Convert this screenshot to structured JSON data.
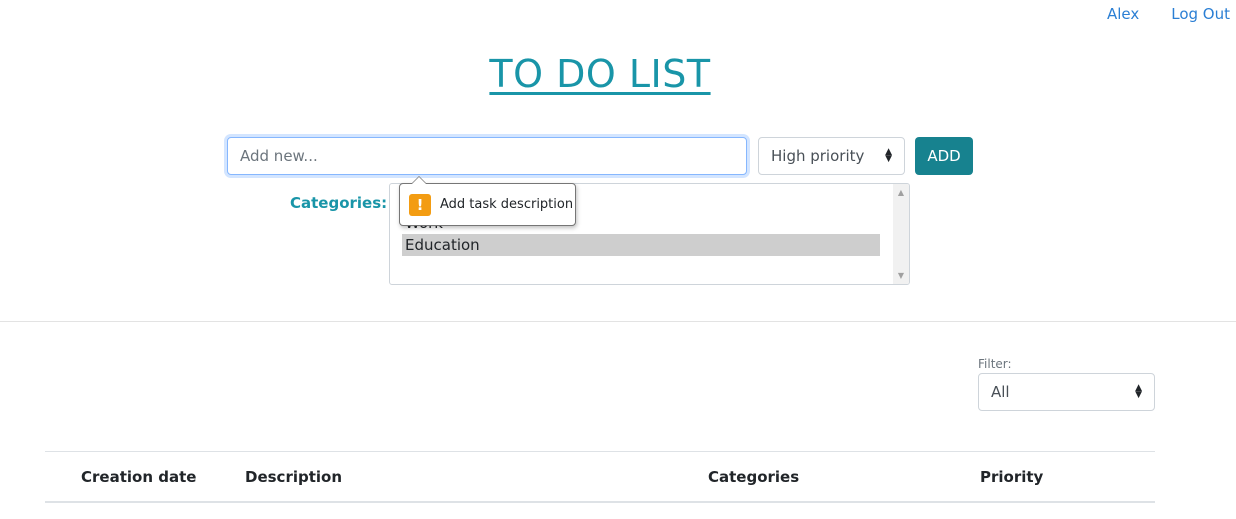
{
  "nav": {
    "user": "Alex",
    "logout": "Log Out"
  },
  "title": "TO DO LIST",
  "form": {
    "task_placeholder": "Add new...",
    "priority_selected": "High priority",
    "add_label": "ADD",
    "categories_label": "Categories:",
    "categories": [
      {
        "label": "Work",
        "selected": false
      },
      {
        "label": "Education",
        "selected": true
      }
    ],
    "validation_tooltip": "Add task description"
  },
  "filter": {
    "label": "Filter:",
    "selected": "All"
  },
  "table": {
    "columns": [
      "Creation date",
      "Description",
      "Categories",
      "Priority"
    ]
  },
  "colors": {
    "accent": "#1995a8",
    "button": "#17828f",
    "link": "#2b7fd4",
    "warning": "#f39c12"
  }
}
